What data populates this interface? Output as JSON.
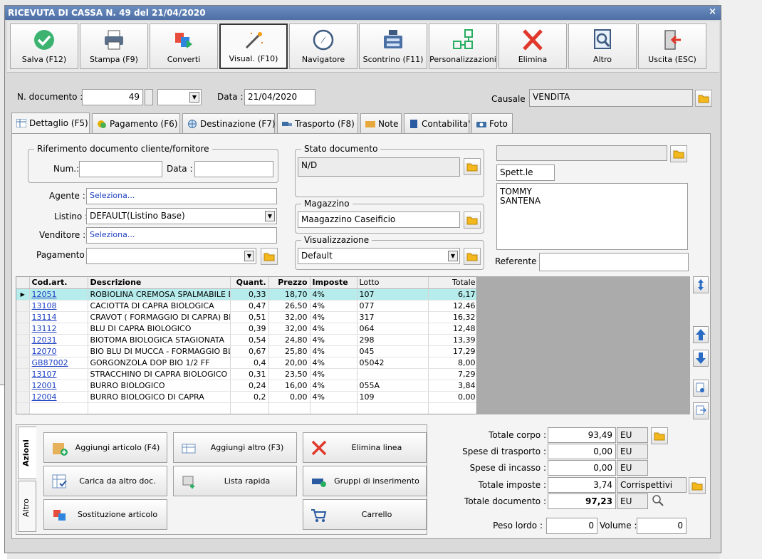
{
  "window": {
    "title": "RICEVUTA DI CASSA N. 49 del 21/04/2020",
    "close": "×"
  },
  "toolbar": [
    {
      "label": "Salva (F12)",
      "icon": "check-icon"
    },
    {
      "label": "Stampa (F9)",
      "icon": "printer-icon"
    },
    {
      "label": "Converti",
      "icon": "convert-icon"
    },
    {
      "label": "Visual. (F10)",
      "icon": "wand-icon"
    },
    {
      "label": "Navigatore",
      "icon": "compass-icon"
    },
    {
      "label": "Scontrino (F11)",
      "icon": "cash-register-icon"
    },
    {
      "label": "Personalizzazioni",
      "icon": "blocks-icon"
    },
    {
      "label": "Elimina",
      "icon": "delete-x-icon"
    },
    {
      "label": "Altro",
      "icon": "magnifier-icon"
    },
    {
      "label": "Uscita (ESC)",
      "icon": "exit-door-icon"
    }
  ],
  "header": {
    "doc_num_label": "N. documento :",
    "doc_num": "49",
    "suffix": "",
    "date_label": "Data :",
    "date": "21/04/2020",
    "causale_label": "Causale :",
    "causale": "VENDITA"
  },
  "tabs": [
    "Dettaglio (F5)",
    "Pagamento (F6)",
    "Destinazione (F7)",
    "Trasporto (F8)",
    "Note",
    "Contabilita'",
    "Foto"
  ],
  "detail": {
    "rif_title": "Riferimento documento cliente/fornitore",
    "num_label": "Num.:",
    "num_value": "",
    "data_label": "Data :",
    "data_value": "",
    "agente_label": "Agente :",
    "agente": "Seleziona...",
    "listino_label": "Listino :",
    "listino": "DEFAULT(Listino Base)",
    "venditore_label": "Venditore :",
    "venditore": "Seleziona...",
    "pagamento_label": "Pagamento :",
    "pagamento": "",
    "stato_title": "Stato documento",
    "stato": "N/D",
    "magazzino_title": "Magazzino",
    "magazzino": "Maagazzino Caseificio",
    "visual_title": "Visualizzazione",
    "visual": "Default",
    "customer_top": "",
    "spett": "Spett.le",
    "customer_line1": "TOMMY",
    "customer_line2": "SANTENA",
    "referente_label": "Referente",
    "referente": ""
  },
  "grid": {
    "columns": [
      "",
      "Cod.art.",
      "Descrizione",
      "Quant.",
      "Prezzo",
      "Imposte",
      "Lotto",
      "Totale"
    ],
    "rows": [
      [
        "12051",
        "ROBIOLINA CREMOSA SPALMABILE B...",
        "0,33",
        "18,70",
        "4%",
        "107",
        "6,17"
      ],
      [
        "13108",
        "CACIOTTA DI CAPRA BIOLOGICA",
        "0,47",
        "26,50",
        "4%",
        "077",
        "12,46"
      ],
      [
        "13114",
        "CRAVOT ( FORMAGGIO DI CAPRA) BI...",
        "0,51",
        "32,00",
        "4%",
        "317",
        "16,32"
      ],
      [
        "13112",
        "BLU DI CAPRA BIOLOGICO",
        "0,39",
        "32,00",
        "4%",
        "064",
        "12,48"
      ],
      [
        "12031",
        "BIOTOMA BIOLOGICA STAGIONATA",
        "0,54",
        "24,80",
        "4%",
        "298",
        "13,39"
      ],
      [
        "12070",
        "BIO BLU DI MUCCA - FORMAGGIO BL...",
        "0,67",
        "25,80",
        "4%",
        "045",
        "17,29"
      ],
      [
        "GB87002",
        "GORGONZOLA DOP BIO 1/2 FF",
        "0,4",
        "20,00",
        "4%",
        "05042",
        "8,00"
      ],
      [
        "13107",
        "STRACCHINO DI CAPRA BIOLOGICO",
        "0,31",
        "23,50",
        "4%",
        "",
        "7,29"
      ],
      [
        "12001",
        "BURRO BIOLOGICO",
        "0,24",
        "16,00",
        "4%",
        "055A",
        "3,84"
      ],
      [
        "12004",
        "BURRO BIOLOGICO DI CAPRA",
        "0,2",
        "0,00",
        "4%",
        "109",
        "0,00"
      ]
    ]
  },
  "actions": {
    "vtab_azioni": "Azioni",
    "vtab_altro": "Altro",
    "buttons": [
      {
        "label": "Aggiungi articolo (F4)",
        "icon": "add-article-icon"
      },
      {
        "label": "Aggiungi altro (F3)",
        "icon": "add-other-icon"
      },
      {
        "label": "Elimina linea",
        "icon": "delete-line-icon"
      },
      {
        "label": "Carica da altro doc.",
        "icon": "load-doc-icon"
      },
      {
        "label": "Lista rapida",
        "icon": "quick-list-icon"
      },
      {
        "label": "Gruppi di inserimento",
        "icon": "insert-group-icon"
      },
      {
        "label": "Sostituzione articolo",
        "icon": "replace-article-icon"
      },
      {
        "label": "Carrello",
        "icon": "cart-icon"
      }
    ]
  },
  "totals": {
    "corpo_label": "Totale corpo :",
    "corpo": "93,49",
    "corpo_cur": "EU",
    "trasporto_label": "Spese di trasporto :",
    "trasporto": "0,00",
    "trasporto_cur": "EU",
    "incasso_label": "Spese di incasso :",
    "incasso": "0,00",
    "incasso_cur": "EU",
    "imposte_label": "Totale imposte :",
    "imposte": "3,74",
    "imposte_extra": "Corrispettivi",
    "documento_label": "Totale documento :",
    "documento": "97,23",
    "documento_cur": "EU",
    "peso_label": "Peso lordo :",
    "peso": "0",
    "volume_label": "Volume :",
    "volume": "0"
  }
}
